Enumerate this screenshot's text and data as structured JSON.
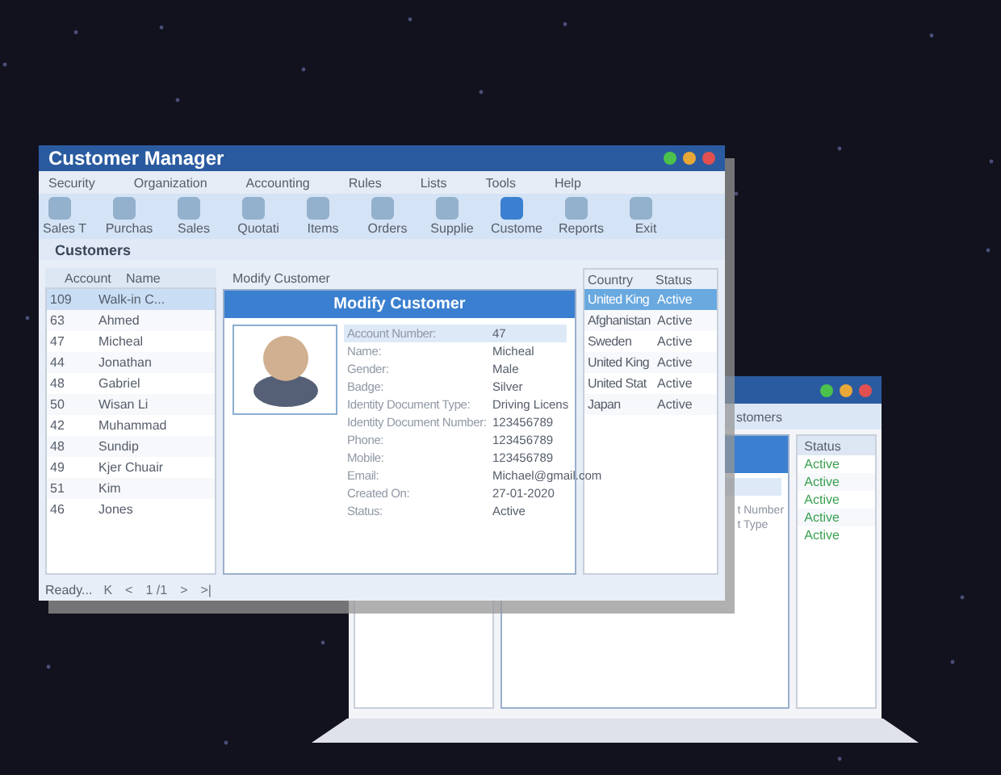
{
  "back_window": {
    "tab_fragment": "stomers",
    "field_fragments": [
      "t Number",
      "t Type"
    ],
    "status_header": "Status",
    "statuses": [
      "Active",
      "Active",
      "Active",
      "Active",
      "Active"
    ]
  },
  "window": {
    "title": "Customer Manager"
  },
  "menu": [
    "Security",
    "Organization",
    "Accounting",
    "Rules",
    "Lists",
    "Tools",
    "Help"
  ],
  "toolbar": [
    {
      "label": "Sales T",
      "selected": false
    },
    {
      "label": "Purchas",
      "selected": false
    },
    {
      "label": "Sales",
      "selected": false
    },
    {
      "label": "Quotati",
      "selected": false
    },
    {
      "label": "Items",
      "selected": false
    },
    {
      "label": "Orders",
      "selected": false
    },
    {
      "label": "Supplie",
      "selected": false
    },
    {
      "label": "Custome",
      "selected": true
    },
    {
      "label": "Reports",
      "selected": false
    },
    {
      "label": "Exit",
      "selected": false
    }
  ],
  "section_title": "Customers",
  "customers": {
    "columns": [
      "Account",
      "Name"
    ],
    "rows": [
      {
        "account": "109",
        "name": "Walk-in C...",
        "selected": true
      },
      {
        "account": "63",
        "name": "Ahmed",
        "selected": false
      },
      {
        "account": "47",
        "name": "Micheal",
        "selected": false
      },
      {
        "account": "44",
        "name": "Jonathan",
        "selected": false
      },
      {
        "account": "48",
        "name": "Gabriel",
        "selected": false
      },
      {
        "account": "50",
        "name": "Wisan Li",
        "selected": false
      },
      {
        "account": "42",
        "name": "Muhammad",
        "selected": false
      },
      {
        "account": "48",
        "name": "Sundip",
        "selected": false
      },
      {
        "account": "49",
        "name": "Kjer Chuair",
        "selected": false
      },
      {
        "account": "51",
        "name": "Kim",
        "selected": false
      },
      {
        "account": "46",
        "name": "Jones",
        "selected": false
      }
    ]
  },
  "form": {
    "panel_title": "Modify Customer",
    "title": "Modify Customer",
    "fields": [
      {
        "label": "Account Number:",
        "value": "47",
        "selected": true
      },
      {
        "label": "Name:",
        "value": "Micheal",
        "selected": false
      },
      {
        "label": "Gender:",
        "value": "Male",
        "selected": false
      },
      {
        "label": "Badge:",
        "value": "Silver",
        "selected": false
      },
      {
        "label": "Identity Document Type:",
        "value": "Driving Licens",
        "selected": false
      },
      {
        "label": "Identity Document Number:",
        "value": "123456789",
        "selected": false
      },
      {
        "label": "Phone:",
        "value": "123456789",
        "selected": false
      },
      {
        "label": "Mobile:",
        "value": "123456789",
        "selected": false
      },
      {
        "label": "Email:",
        "value": "Michael@gmail.com",
        "selected": false
      },
      {
        "label": "Created On:",
        "value": "27-01-2020",
        "selected": false
      },
      {
        "label": "Status:",
        "value": "Active",
        "selected": false
      }
    ]
  },
  "countries": {
    "columns": [
      "Country",
      "Status"
    ],
    "rows": [
      {
        "country": "United King",
        "status": "Active",
        "selected": true
      },
      {
        "country": "Afghanistan",
        "status": "Active",
        "selected": false
      },
      {
        "country": "Sweden",
        "status": "Active",
        "selected": false
      },
      {
        "country": "United King",
        "status": "Active",
        "selected": false
      },
      {
        "country": "United Stat",
        "status": "Active",
        "selected": false
      },
      {
        "country": "Japan",
        "status": "Active",
        "selected": false
      }
    ]
  },
  "status_bar": {
    "text": "Ready...",
    "pager": [
      "K",
      "<",
      "1 /1",
      ">",
      ">|"
    ]
  }
}
